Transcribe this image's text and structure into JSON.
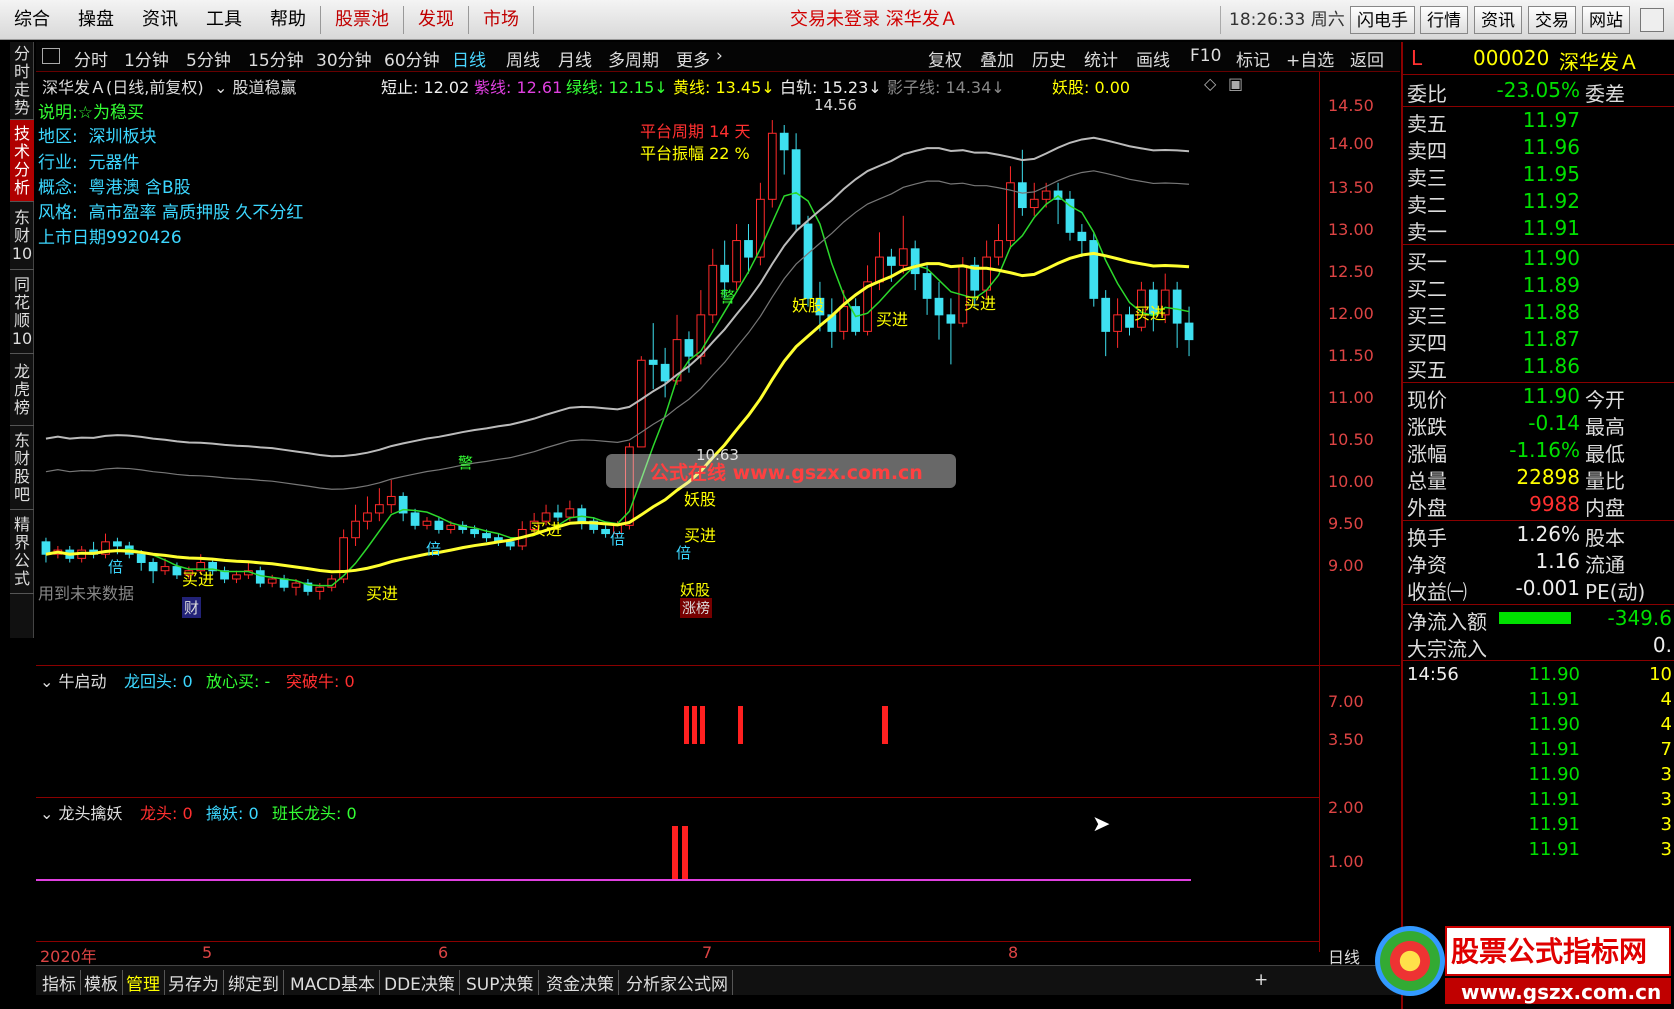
{
  "menubar": {
    "items": [
      "综合",
      "操盘",
      "资讯",
      "工具",
      "帮助"
    ],
    "red_items": [
      "股票池",
      "发现",
      "市场"
    ],
    "status": "交易未登录  深华发Ａ",
    "clock": "18:26:33 周六",
    "buttons": [
      "闪电手",
      "行情",
      "资讯",
      "交易",
      "网站"
    ]
  },
  "leftnav": {
    "tabs": [
      "分时走势",
      "技术分析",
      "东财10",
      "同花顺10",
      "龙虎榜",
      "东财股吧",
      "精界公式"
    ]
  },
  "periodbar": {
    "periods": [
      "分时",
      "1分钟",
      "5分钟",
      "15分钟",
      "30分钟",
      "60分钟",
      "日线",
      "周线",
      "月线",
      "多周期",
      "更多"
    ],
    "active": "日线",
    "tools": [
      "复权",
      "叠加",
      "历史",
      "统计",
      "画线",
      "F10",
      "标记",
      "+自选",
      "返回"
    ]
  },
  "chart_header": {
    "title": "深华发Ａ(日线,前复权)",
    "formula": "股道稳赢",
    "stop_label": "短止: 12.02",
    "purple_label": "紫线: 12.61",
    "green_label": "绿线: 12.15↓",
    "yellow_label": "黄线: 13.45↓",
    "white_label": "白轨: 15.23↓",
    "shadow_label": "影子线: 14.34↓",
    "demon_label": "妖股: 0.00"
  },
  "stock_info": {
    "desc_label": "说明:",
    "desc_value": "☆为稳买",
    "region_label": "地区:",
    "region_value": "深圳板块",
    "industry_label": "行业:",
    "industry_value": "元器件",
    "concept_label": "概念:",
    "concept_value": "粤港澳 含B股",
    "style_label": "风格:",
    "style_value": "高市盈率 高质押股 久不分红",
    "listing": "上市日期9920426"
  },
  "annotations": {
    "platform_period": "平台周期 14 天",
    "platform_range": "平台振幅 22 %",
    "peak_label": "14.56",
    "future_data": "用到未来数据",
    "buy_label": "买进",
    "demon": "妖股",
    "limit_up": "涨榜",
    "warn": "警",
    "double": "倍",
    "money": "财",
    "low_label": "10.63",
    "watermark": "公式在线  www.gszx.com.cn"
  },
  "main_yaxis": [
    "14.50",
    "14.00",
    "13.50",
    "13.00",
    "12.50",
    "12.00",
    "11.50",
    "11.00",
    "10.50",
    "10.00",
    "9.50",
    "9.00"
  ],
  "ind1": {
    "title": "牛启动",
    "l1": "龙回头: 0",
    "l2": "放心买: -",
    "l3": "突破牛: 0",
    "yaxis": [
      "7.00",
      "3.50"
    ]
  },
  "ind2": {
    "title": "龙头擒妖",
    "l1": "龙头: 0",
    "l2": "擒妖: 0",
    "l3": "班长龙头: 0",
    "yaxis": [
      "2.00",
      "1.00"
    ]
  },
  "xaxis": {
    "labels": [
      "2020年",
      "5",
      "6",
      "7",
      "8"
    ],
    "right": "日线"
  },
  "bottombar": {
    "tabs": [
      "指标",
      "模板",
      "管理",
      "另存为",
      "绑定到",
      "MACD基本",
      "DDE决策",
      "SUP决策",
      "资金决策",
      "分析家公式网"
    ],
    "plus": "+"
  },
  "quote": {
    "flag": "L",
    "code": "000020",
    "name": "深华发Ａ",
    "weibi_label": "委比",
    "weibi_value": "-23.05%",
    "weicha_label": "委差",
    "sells": [
      {
        "label": "卖五",
        "price": "11.97"
      },
      {
        "label": "卖四",
        "price": "11.96"
      },
      {
        "label": "卖三",
        "price": "11.95"
      },
      {
        "label": "卖二",
        "price": "11.92"
      },
      {
        "label": "卖一",
        "price": "11.91"
      }
    ],
    "buys": [
      {
        "label": "买一",
        "price": "11.90"
      },
      {
        "label": "买二",
        "price": "11.89"
      },
      {
        "label": "买三",
        "price": "11.88"
      },
      {
        "label": "买四",
        "price": "11.87"
      },
      {
        "label": "买五",
        "price": "11.86"
      }
    ],
    "stats": [
      {
        "label": "现价",
        "value": "11.90",
        "label2": "今开",
        "color": "#00e000"
      },
      {
        "label": "涨跌",
        "value": "-0.14",
        "label2": "最高",
        "color": "#00e000"
      },
      {
        "label": "涨幅",
        "value": "-1.16%",
        "label2": "最低",
        "color": "#00e000"
      },
      {
        "label": "总量",
        "value": "22898",
        "label2": "量比",
        "color": "#ffff00"
      },
      {
        "label": "外盘",
        "value": "9988",
        "label2": "内盘",
        "color": "#ff3030"
      }
    ],
    "stats2": [
      {
        "label": "换手",
        "value": "1.26%",
        "label2": "股本"
      },
      {
        "label": "净资",
        "value": "1.16",
        "label2": "流通"
      },
      {
        "label": "收益㈠",
        "value": "-0.001",
        "label2": "PE(动)"
      }
    ],
    "netflow_label": "净流入额",
    "netflow_value": "-349.6",
    "block_label": "大宗流入",
    "block_value": "0.",
    "ticks_time": "14:56",
    "ticks": [
      "11.90",
      "11.91",
      "11.90",
      "11.91",
      "11.90",
      "11.91",
      "11.91",
      "11.91"
    ],
    "ticks_vol": [
      "10",
      "4",
      "4",
      "7",
      "3",
      "3",
      "3",
      "3"
    ]
  },
  "logo": {
    "text": "股票公式指标网",
    "url": "www.gszx.com.cn",
    "brand": "分析家公式网"
  },
  "chart_data": {
    "type": "candlestick",
    "y_range": [
      8.6,
      14.9
    ],
    "candles": [
      {
        "o": 9.45,
        "c": 9.3,
        "h": 9.5,
        "l": 9.2
      },
      {
        "o": 9.3,
        "c": 9.35,
        "h": 9.4,
        "l": 9.25
      },
      {
        "o": 9.35,
        "c": 9.25,
        "h": 9.4,
        "l": 9.2
      },
      {
        "o": 9.25,
        "c": 9.35,
        "h": 9.4,
        "l": 9.2
      },
      {
        "o": 9.35,
        "c": 9.3,
        "h": 9.45,
        "l": 9.25
      },
      {
        "o": 9.3,
        "c": 9.45,
        "h": 9.55,
        "l": 9.25
      },
      {
        "o": 9.45,
        "c": 9.4,
        "h": 9.5,
        "l": 9.3
      },
      {
        "o": 9.4,
        "c": 9.3,
        "h": 9.45,
        "l": 9.25
      },
      {
        "o": 9.3,
        "c": 9.2,
        "h": 9.35,
        "l": 9.1
      },
      {
        "o": 9.2,
        "c": 9.1,
        "h": 9.25,
        "l": 8.95
      },
      {
        "o": 9.1,
        "c": 9.15,
        "h": 9.25,
        "l": 9.05
      },
      {
        "o": 9.15,
        "c": 9.05,
        "h": 9.2,
        "l": 9.0
      },
      {
        "o": 9.05,
        "c": 9.1,
        "h": 9.15,
        "l": 9.0
      },
      {
        "o": 9.1,
        "c": 9.2,
        "h": 9.3,
        "l": 9.05
      },
      {
        "o": 9.2,
        "c": 9.1,
        "h": 9.25,
        "l": 9.05
      },
      {
        "o": 9.1,
        "c": 9.0,
        "h": 9.15,
        "l": 8.95
      },
      {
        "o": 9.0,
        "c": 9.05,
        "h": 9.1,
        "l": 8.95
      },
      {
        "o": 9.05,
        "c": 9.1,
        "h": 9.2,
        "l": 9.0
      },
      {
        "o": 9.1,
        "c": 8.95,
        "h": 9.15,
        "l": 8.9
      },
      {
        "o": 8.95,
        "c": 9.0,
        "h": 9.05,
        "l": 8.9
      },
      {
        "o": 9.0,
        "c": 8.9,
        "h": 9.05,
        "l": 8.85
      },
      {
        "o": 8.9,
        "c": 8.95,
        "h": 9.0,
        "l": 8.8
      },
      {
        "o": 8.95,
        "c": 8.85,
        "h": 9.0,
        "l": 8.8
      },
      {
        "o": 8.85,
        "c": 8.9,
        "h": 8.95,
        "l": 8.75
      },
      {
        "o": 8.9,
        "c": 9.0,
        "h": 9.05,
        "l": 8.85
      },
      {
        "o": 9.0,
        "c": 9.5,
        "h": 9.6,
        "l": 8.95
      },
      {
        "o": 9.5,
        "c": 9.7,
        "h": 9.9,
        "l": 9.4
      },
      {
        "o": 9.7,
        "c": 9.8,
        "h": 10.0,
        "l": 9.6
      },
      {
        "o": 9.8,
        "c": 9.9,
        "h": 10.1,
        "l": 9.7
      },
      {
        "o": 9.9,
        "c": 10.0,
        "h": 10.2,
        "l": 9.8
      },
      {
        "o": 10.0,
        "c": 9.8,
        "h": 10.05,
        "l": 9.7
      },
      {
        "o": 9.8,
        "c": 9.65,
        "h": 9.85,
        "l": 9.6
      },
      {
        "o": 9.65,
        "c": 9.7,
        "h": 9.75,
        "l": 9.6
      },
      {
        "o": 9.7,
        "c": 9.6,
        "h": 9.75,
        "l": 9.55
      },
      {
        "o": 9.6,
        "c": 9.65,
        "h": 9.7,
        "l": 9.55
      },
      {
        "o": 9.65,
        "c": 9.6,
        "h": 9.7,
        "l": 9.55
      },
      {
        "o": 9.6,
        "c": 9.55,
        "h": 9.65,
        "l": 9.5
      },
      {
        "o": 9.55,
        "c": 9.5,
        "h": 9.6,
        "l": 9.45
      },
      {
        "o": 9.5,
        "c": 9.45,
        "h": 9.55,
        "l": 9.4
      },
      {
        "o": 9.45,
        "c": 9.4,
        "h": 9.5,
        "l": 9.35
      },
      {
        "o": 9.4,
        "c": 9.6,
        "h": 9.7,
        "l": 9.35
      },
      {
        "o": 9.6,
        "c": 9.7,
        "h": 9.8,
        "l": 9.55
      },
      {
        "o": 9.7,
        "c": 9.8,
        "h": 9.9,
        "l": 9.65
      },
      {
        "o": 9.8,
        "c": 9.75,
        "h": 9.9,
        "l": 9.7
      },
      {
        "o": 9.75,
        "c": 9.85,
        "h": 9.95,
        "l": 9.7
      },
      {
        "o": 9.85,
        "c": 9.7,
        "h": 9.9,
        "l": 9.6
      },
      {
        "o": 9.7,
        "c": 9.6,
        "h": 9.75,
        "l": 9.55
      },
      {
        "o": 9.6,
        "c": 9.55,
        "h": 9.65,
        "l": 9.5
      },
      {
        "o": 9.55,
        "c": 9.65,
        "h": 9.7,
        "l": 9.5
      },
      {
        "o": 9.65,
        "c": 10.6,
        "h": 10.65,
        "l": 9.6
      },
      {
        "o": 10.6,
        "c": 11.65,
        "h": 11.7,
        "l": 10.6
      },
      {
        "o": 11.65,
        "c": 11.6,
        "h": 12.1,
        "l": 11.3
      },
      {
        "o": 11.6,
        "c": 11.4,
        "h": 11.8,
        "l": 11.2
      },
      {
        "o": 11.4,
        "c": 11.9,
        "h": 12.2,
        "l": 11.35
      },
      {
        "o": 11.9,
        "c": 11.7,
        "h": 12.0,
        "l": 11.5
      },
      {
        "o": 11.7,
        "c": 12.2,
        "h": 12.5,
        "l": 11.6
      },
      {
        "o": 12.2,
        "c": 12.8,
        "h": 13.0,
        "l": 12.1
      },
      {
        "o": 12.8,
        "c": 12.6,
        "h": 13.1,
        "l": 12.4
      },
      {
        "o": 12.6,
        "c": 13.1,
        "h": 13.3,
        "l": 12.5
      },
      {
        "o": 13.1,
        "c": 12.9,
        "h": 13.3,
        "l": 12.7
      },
      {
        "o": 12.9,
        "c": 13.6,
        "h": 13.8,
        "l": 12.8
      },
      {
        "o": 13.6,
        "c": 14.4,
        "h": 14.56,
        "l": 13.5
      },
      {
        "o": 14.4,
        "c": 14.2,
        "h": 14.5,
        "l": 13.9
      },
      {
        "o": 14.2,
        "c": 13.3,
        "h": 14.4,
        "l": 13.2
      },
      {
        "o": 13.3,
        "c": 12.4,
        "h": 13.4,
        "l": 12.3
      },
      {
        "o": 12.4,
        "c": 12.2,
        "h": 12.6,
        "l": 12.0
      },
      {
        "o": 12.2,
        "c": 12.0,
        "h": 12.4,
        "l": 11.8
      },
      {
        "o": 12.0,
        "c": 12.3,
        "h": 12.5,
        "l": 11.9
      },
      {
        "o": 12.3,
        "c": 12.0,
        "h": 12.4,
        "l": 11.95
      },
      {
        "o": 12.0,
        "c": 12.6,
        "h": 12.8,
        "l": 11.95
      },
      {
        "o": 12.6,
        "c": 12.9,
        "h": 13.2,
        "l": 12.5
      },
      {
        "o": 12.9,
        "c": 12.8,
        "h": 13.0,
        "l": 12.6
      },
      {
        "o": 12.8,
        "c": 13.0,
        "h": 13.4,
        "l": 12.7
      },
      {
        "o": 13.0,
        "c": 12.7,
        "h": 13.1,
        "l": 12.5
      },
      {
        "o": 12.7,
        "c": 12.4,
        "h": 12.8,
        "l": 12.2
      },
      {
        "o": 12.4,
        "c": 12.2,
        "h": 12.6,
        "l": 11.9
      },
      {
        "o": 12.2,
        "c": 12.1,
        "h": 12.4,
        "l": 11.6
      },
      {
        "o": 12.1,
        "c": 12.8,
        "h": 12.9,
        "l": 12.05
      },
      {
        "o": 12.8,
        "c": 12.5,
        "h": 12.9,
        "l": 12.3
      },
      {
        "o": 12.5,
        "c": 12.9,
        "h": 13.1,
        "l": 12.4
      },
      {
        "o": 12.9,
        "c": 13.1,
        "h": 13.3,
        "l": 12.8
      },
      {
        "o": 13.1,
        "c": 13.8,
        "h": 14.0,
        "l": 13.0
      },
      {
        "o": 13.8,
        "c": 13.5,
        "h": 14.2,
        "l": 13.4
      },
      {
        "o": 13.5,
        "c": 13.6,
        "h": 13.8,
        "l": 13.4
      },
      {
        "o": 13.6,
        "c": 13.7,
        "h": 13.8,
        "l": 13.5
      },
      {
        "o": 13.7,
        "c": 13.6,
        "h": 13.8,
        "l": 13.3
      },
      {
        "o": 13.6,
        "c": 13.2,
        "h": 13.7,
        "l": 13.1
      },
      {
        "o": 13.2,
        "c": 13.1,
        "h": 13.3,
        "l": 12.9
      },
      {
        "o": 13.1,
        "c": 12.4,
        "h": 13.2,
        "l": 12.3
      },
      {
        "o": 12.4,
        "c": 12.0,
        "h": 12.5,
        "l": 11.7
      },
      {
        "o": 12.0,
        "c": 12.2,
        "h": 12.4,
        "l": 11.8
      },
      {
        "o": 12.2,
        "c": 12.05,
        "h": 12.3,
        "l": 11.95
      },
      {
        "o": 12.05,
        "c": 12.5,
        "h": 12.6,
        "l": 12.0
      },
      {
        "o": 12.5,
        "c": 12.2,
        "h": 12.6,
        "l": 12.0
      },
      {
        "o": 12.2,
        "c": 12.5,
        "h": 12.7,
        "l": 12.1
      },
      {
        "o": 12.5,
        "c": 12.1,
        "h": 12.6,
        "l": 11.8
      },
      {
        "o": 12.1,
        "c": 11.9,
        "h": 12.3,
        "l": 11.7
      }
    ]
  }
}
